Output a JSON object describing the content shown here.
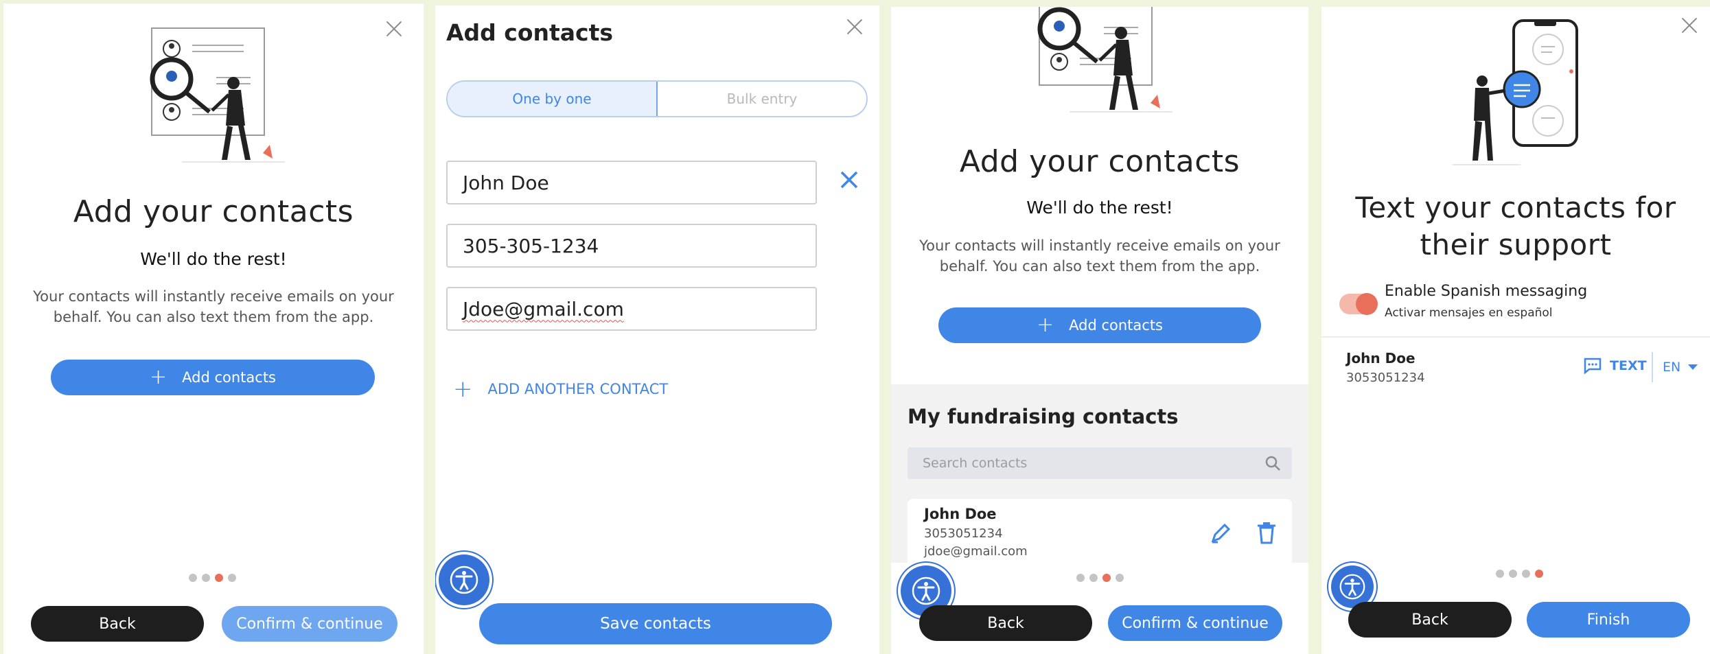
{
  "panel1": {
    "title": "Add your contacts",
    "subtitle": "We'll do the rest!",
    "body": "Your contacts will instantly receive emails on your behalf. You can also text them from the app.",
    "add_label": "Add contacts",
    "back_label": "Back",
    "confirm_label": "Confirm & continue",
    "step": 3,
    "steps": 4
  },
  "panel2": {
    "title": "Add contacts",
    "tabs": [
      "One by one",
      "Bulk entry"
    ],
    "name_value": "John Doe",
    "phone_value": "305-305-1234",
    "email_value": "Jdoe@gmail.com",
    "add_another_label": "ADD ANOTHER CONTACT",
    "save_label": "Save contacts"
  },
  "panel3": {
    "title": "Add your contacts",
    "subtitle": "We'll do the rest!",
    "body": "Your contacts will instantly receive emails on your behalf. You can also text them from the app.",
    "add_label": "Add contacts",
    "section_title": "My fundraising contacts",
    "search_placeholder": "Search contacts",
    "contact": {
      "name": "John Doe",
      "phone": "3053051234",
      "email": "jdoe@gmail.com"
    },
    "back_label": "Back",
    "confirm_label": "Confirm & continue",
    "step": 3,
    "steps": 4
  },
  "panel4": {
    "title_line1": "Text your contacts for",
    "title_line2": "their support",
    "toggle_label": "Enable Spanish messaging",
    "toggle_sublabel": "Activar mensajes en español",
    "contact": {
      "name": "John Doe",
      "phone": "3053051234"
    },
    "text_label": "TEXT",
    "lang": "EN",
    "back_label": "Back",
    "finish_label": "Finish",
    "step": 4,
    "steps": 4
  },
  "colors": {
    "primary": "#3f86e6",
    "dark": "#1e1e1e",
    "accent": "#e8705a",
    "toggle": "#e8705a"
  }
}
